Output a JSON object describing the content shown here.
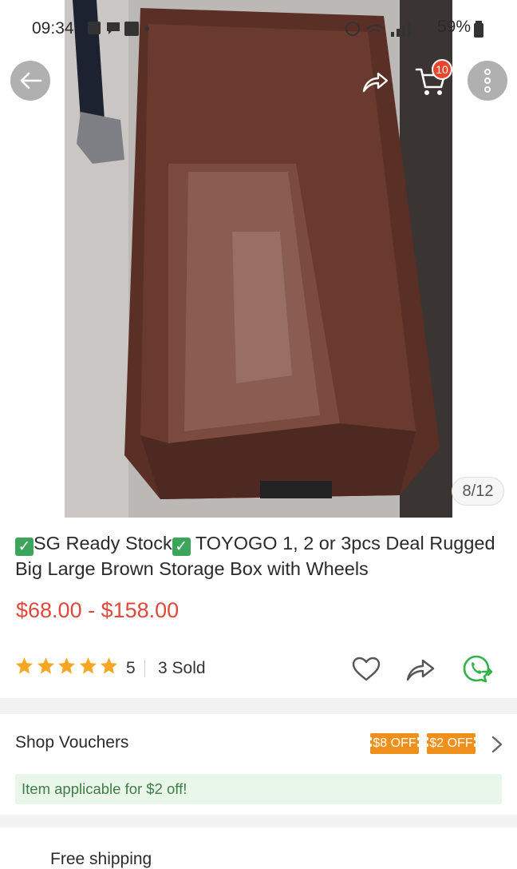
{
  "status_bar": {
    "time": "09:34",
    "battery": "59%"
  },
  "gallery": {
    "counter": "8/12",
    "cart_count": "10"
  },
  "product": {
    "title_part1": "SG Ready Stock",
    "title_part2": " TOYOGO 1, 2 or 3pcs Deal Rugged Big Large Brown Storage Box with Wheels",
    "price": "$68.00 - $158.00",
    "rating_stars": 5,
    "rating_count": "5",
    "sold": "3 Sold"
  },
  "vouchers": {
    "label": "Shop Vouchers",
    "tags": [
      "$8 OFF",
      "$2 OFF"
    ],
    "applicable": "Item applicable for $2 off!"
  },
  "shipping": {
    "label": "Free shipping"
  },
  "colors": {
    "price": "#e0493a",
    "voucher_tag": "#f0901c",
    "badge": "#e8452c",
    "whatsapp": "#2fb34a",
    "check": "#3ba55c"
  },
  "icons": [
    "back-arrow-icon",
    "share-icon",
    "cart-icon",
    "more-vertical-icon",
    "star-icon",
    "heart-icon",
    "share-icon",
    "whatsapp-icon",
    "chevron-right-icon"
  ]
}
